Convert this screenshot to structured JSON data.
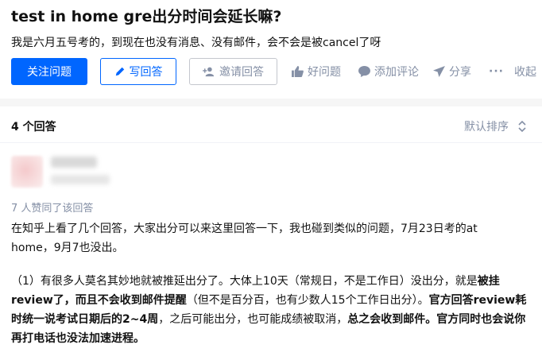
{
  "question": {
    "title": "test in home gre出分时间会延长嘛?",
    "detail": "我是六月五号考的，到现在也没有消息、没有邮件，会不会是被cancel了呀"
  },
  "actions": {
    "follow": "关注问题",
    "write": "写回答",
    "invite": "邀请回答",
    "good_question": "好问题",
    "add_comment": "添加评论",
    "share": "分享",
    "more": "···",
    "collapse": "收起"
  },
  "answers": {
    "count_label": "4 个回答",
    "sort_label": "默认排序",
    "first": {
      "upvote_text": "7 人赞同了该回答",
      "para1_line1": "在知乎上看了几个回答，大家出分可以来这里回答一下，我也碰到类似的问题，7月23日考的at",
      "para1_line2": "home，9月7也没出。",
      "p2_a": "（1）有很多人莫名其妙地就被推延出分了。大体上10天（常规日，不是工作日）没出分，就是",
      "p2_b": "被挂review了，而且不会收到邮件提醒",
      "p2_c": "（但不是百分百，也有少数人15个工作日出分）。",
      "p2_d": "官方回答review耗时统一说考试日期后的2~4周",
      "p2_e": "，之后可能出分，也可能成绩被取消，",
      "p2_f": "总之会收到邮件。官方同时也会说你再打电话也没法加速进程。"
    }
  },
  "colors": {
    "brand": "#0066ff",
    "muted": "#8590a6",
    "text": "#121212"
  },
  "icons": [
    "pencil-icon",
    "invite-user-icon",
    "thumb-up-icon",
    "comment-icon",
    "share-plane-icon",
    "more-dots-icon",
    "sort-updown-icon"
  ]
}
